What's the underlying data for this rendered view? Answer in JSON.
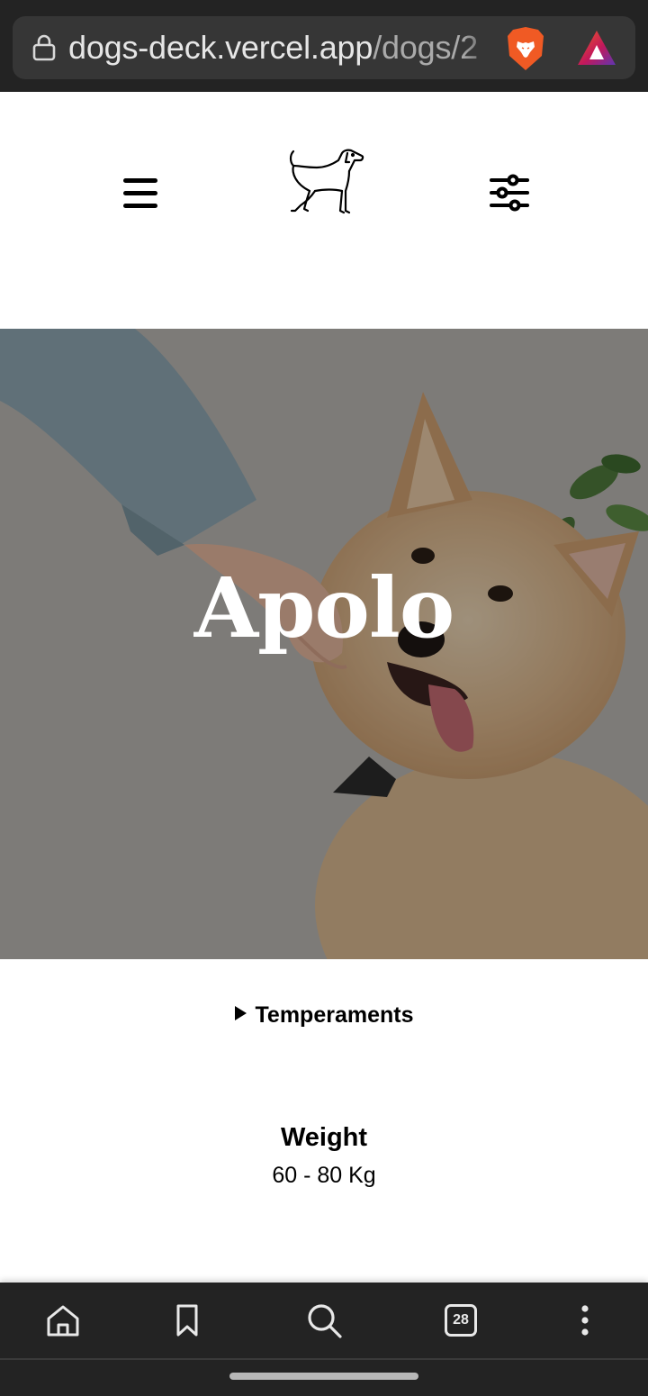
{
  "browser": {
    "url_host": "dogs-deck.vercel.app",
    "url_path": "/dogs/2",
    "icons": [
      "lock-icon",
      "brave-shield-icon",
      "brave-rewards-icon"
    ]
  },
  "header": {
    "icons": [
      "hamburger-menu-icon",
      "dog-logo-icon",
      "filter-sliders-icon"
    ]
  },
  "hero": {
    "dog_name": "Apolo"
  },
  "details": {
    "temperaments_label": "Temperaments",
    "weight_label": "Weight",
    "weight_value": "60 - 80 Kg"
  },
  "bottom_bar": {
    "tab_count": "28",
    "icons": [
      "home-icon",
      "bookmark-icon",
      "search-icon",
      "tabs-icon",
      "more-icon"
    ]
  },
  "colors": {
    "browser_bg": "#232323",
    "urlbar_bg": "#363636",
    "shield": "#f05a24",
    "hero_text": "#ffffff"
  }
}
